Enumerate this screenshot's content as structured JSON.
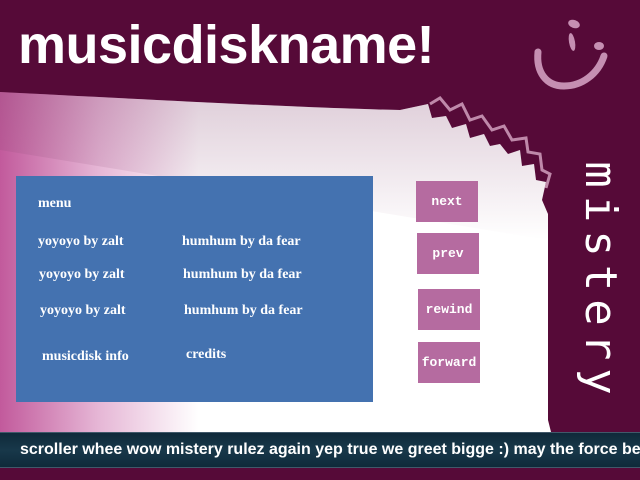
{
  "title": "musicdiskname!",
  "side_label": "mistery",
  "smiley_icon": "smiley-face-icon",
  "menu": {
    "heading": "menu",
    "tracks_left": [
      "yoyoyo by zalt",
      "yoyoyo by zalt",
      "yoyoyo by zalt"
    ],
    "tracks_right": [
      "humhum by da fear",
      "humhum by da fear",
      "humhum by da fear"
    ],
    "info": "musicdisk info",
    "credits": "credits"
  },
  "controls": {
    "next": "next",
    "prev": "prev",
    "rewind": "rewind",
    "forward": "forward"
  },
  "scroller": "scroller whee wow mistery rulez again yep true we greet bigge :) may the force be",
  "colors": {
    "background": "#560a38",
    "panel": "#4472b0",
    "button": "#b56ba0",
    "paper": "#ffffff",
    "scroller_bg": "#18384a"
  }
}
